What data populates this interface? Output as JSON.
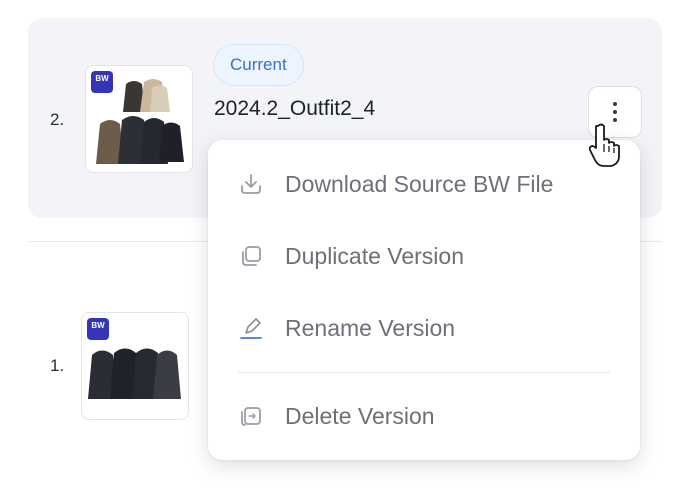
{
  "versions": [
    {
      "index_label": "2.",
      "badge": "Current",
      "name": "2024.2_Outfit2_4",
      "thumb_badge": "BW"
    },
    {
      "index_label": "1.",
      "thumb_badge": "BW"
    }
  ],
  "menu": {
    "items": [
      {
        "label": "Download Source BW File",
        "icon": "download-icon"
      },
      {
        "label": "Duplicate Version",
        "icon": "duplicate-icon"
      },
      {
        "label": "Rename Version",
        "icon": "pencil-icon"
      },
      {
        "label": "Delete Version",
        "icon": "delete-icon"
      }
    ]
  },
  "colors": {
    "badge_text": "#3d6fc4",
    "badge_bg": "#eef4fd",
    "bw_badge": "#3535b8",
    "row_highlight": "#f3f4f8",
    "menu_text": "#6e7079"
  }
}
